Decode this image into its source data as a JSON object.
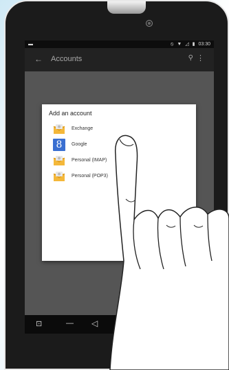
{
  "status_bar": {
    "left_icon": "notification-icon",
    "time": "03:30",
    "icons": [
      "do-not-disturb-icon",
      "wifi-icon",
      "signal-icon",
      "battery-icon"
    ]
  },
  "action_bar": {
    "title": "Accounts",
    "back_icon": "←",
    "search_icon": "⚲",
    "menu_icon": "⋮"
  },
  "dialog": {
    "title": "Add an account",
    "items": [
      {
        "label": "Exchange",
        "icon": "email-envelope-icon"
      },
      {
        "label": "Google",
        "icon": "google-icon",
        "glyph": "8"
      },
      {
        "label": "Personal (IMAP)",
        "icon": "email-envelope-icon"
      },
      {
        "label": "Personal (POP3)",
        "icon": "email-envelope-icon"
      }
    ]
  },
  "nav_bar": {
    "screenshot": "⊡",
    "minus": "—",
    "back": "◁",
    "home": "○",
    "recent": "□"
  },
  "colors": {
    "accent_blue": "#3a6fd1",
    "envelope_yellow": "#f4b83a"
  }
}
